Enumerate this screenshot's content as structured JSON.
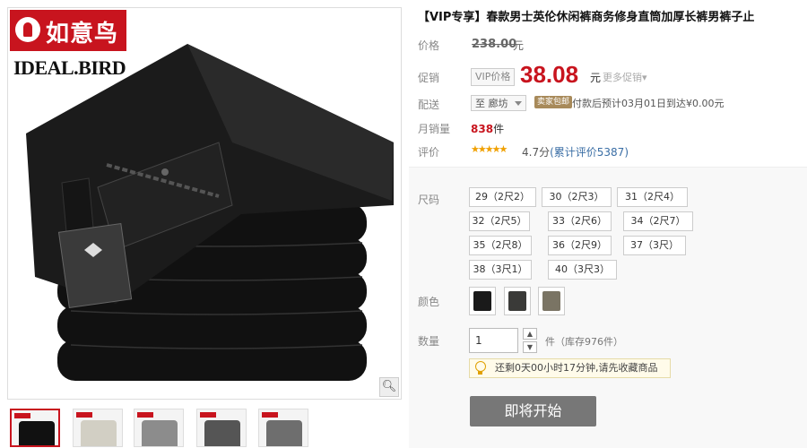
{
  "brand": {
    "logo_cn": "如意鸟",
    "logo_en": "IDEAL.BIRD"
  },
  "product": {
    "title": "【VIP专享】春款男士英伦休闲裤商务修身直筒加厚长裤男裤子止",
    "labels": {
      "price": "价格",
      "promo": "促销",
      "shipping": "配送",
      "monthly_sales": "月销量",
      "rating": "评价",
      "size": "尺码",
      "color": "颜色",
      "quantity": "数量"
    },
    "original_price": "238.00",
    "currency_unit": "元",
    "vip_tag": "VIP价格",
    "price": "38.08",
    "more_promo": "更多促销",
    "ship_location": "至 廊坊",
    "ship_badge": "卖家包邮",
    "ship_text": "付款后预计03月01日到达¥0.00元",
    "sales_count": "838",
    "sales_unit": "件",
    "stars": "★★★★★",
    "score": "4.7分",
    "review_link": "(累计评价5387)",
    "sizes": [
      "29（2尺2）",
      "30（2尺3）",
      "31（2尺4）",
      "32（2尺5）",
      "33（2尺6）",
      "34（2尺7）",
      "35（2尺8）",
      "36（2尺9）",
      "37（3尺）",
      "38（3尺1）",
      "40（3尺3）"
    ],
    "colors": [
      "#1a1a1a",
      "#3a3a38",
      "#7a7464"
    ],
    "quantity_value": "1",
    "stock_text": "件（库存976件）",
    "tip": "还剩0天00小时17分钟,请先收藏商品",
    "buy_button": "即将开始"
  },
  "icons": {
    "zoom": "magnifier-icon",
    "tip": "lightbulb-icon"
  }
}
